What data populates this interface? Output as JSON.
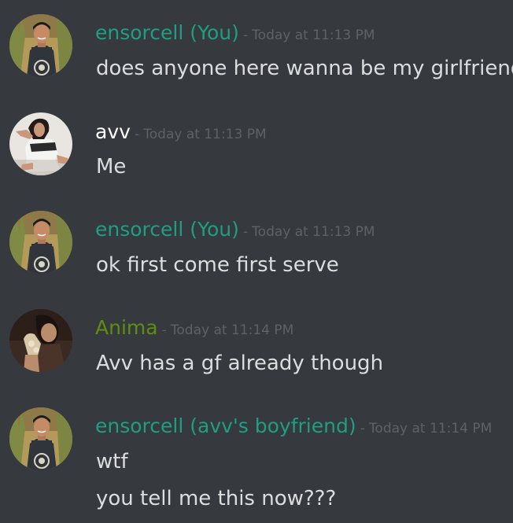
{
  "colors": {
    "background": "#36393e",
    "username_teal": "#1f9e83",
    "username_green": "#5e8e0f",
    "username_white": "#ffffff",
    "timestamp": "#5f6166",
    "message_text": "#dcddde"
  },
  "separator": "-",
  "messages": [
    {
      "username": "ensorcell (You)",
      "timestamp": "Today at 11:13 PM",
      "lines": [
        "does anyone here wanna be my girlfriend"
      ]
    },
    {
      "username": "avv",
      "timestamp": "Today at 11:13 PM",
      "lines": [
        "Me"
      ]
    },
    {
      "username": "ensorcell (You)",
      "timestamp": "Today at 11:13 PM",
      "lines": [
        "ok first come first serve"
      ]
    },
    {
      "username": "Anima",
      "timestamp": "Today at 11:14 PM",
      "lines": [
        "Avv has a gf already though"
      ]
    },
    {
      "username": "ensorcell (avv's boyfriend)",
      "timestamp": "Today at 11:14 PM",
      "lines": [
        "wtf",
        "you tell me this now???"
      ]
    }
  ]
}
